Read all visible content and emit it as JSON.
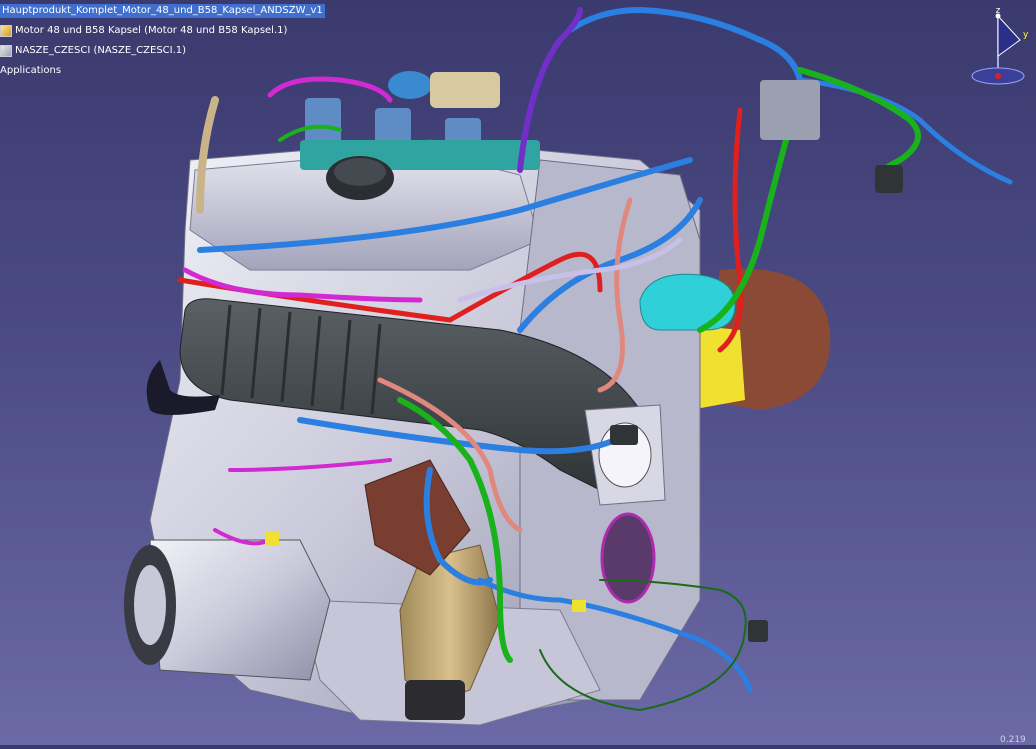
{
  "spec_tree": {
    "root": "Hauptprodukt_Komplet_Motor_48_und_B58_Kapsel_ANDSZW_v1",
    "items": [
      {
        "label": "Motor 48 und B58 Kapsel (Motor 48 und B58 Kapsel.1)",
        "icon": "assembly-icon"
      },
      {
        "label": "NASZE_CZESCI (NASZE_CZESCI.1)",
        "icon": "part-icon"
      },
      {
        "label": "Applications",
        "icon": "applications-icon"
      }
    ]
  },
  "compass": {
    "axis_z": "z",
    "axis_y": "y",
    "icon": "compass-icon"
  },
  "viewport": {
    "scale_readout": "0.219",
    "subject": "engine-3d-model"
  },
  "colors": {
    "background_top": "#3b3a6e",
    "background_bottom": "#6b6aa6",
    "selection": "#3f6fcf",
    "hose_blue": "#2b7fe0",
    "hose_green": "#19b21c",
    "hose_magenta": "#d22ad2",
    "hose_red": "#e0201e",
    "hose_purple": "#7030c8",
    "intake_dark": "#3e4447"
  }
}
